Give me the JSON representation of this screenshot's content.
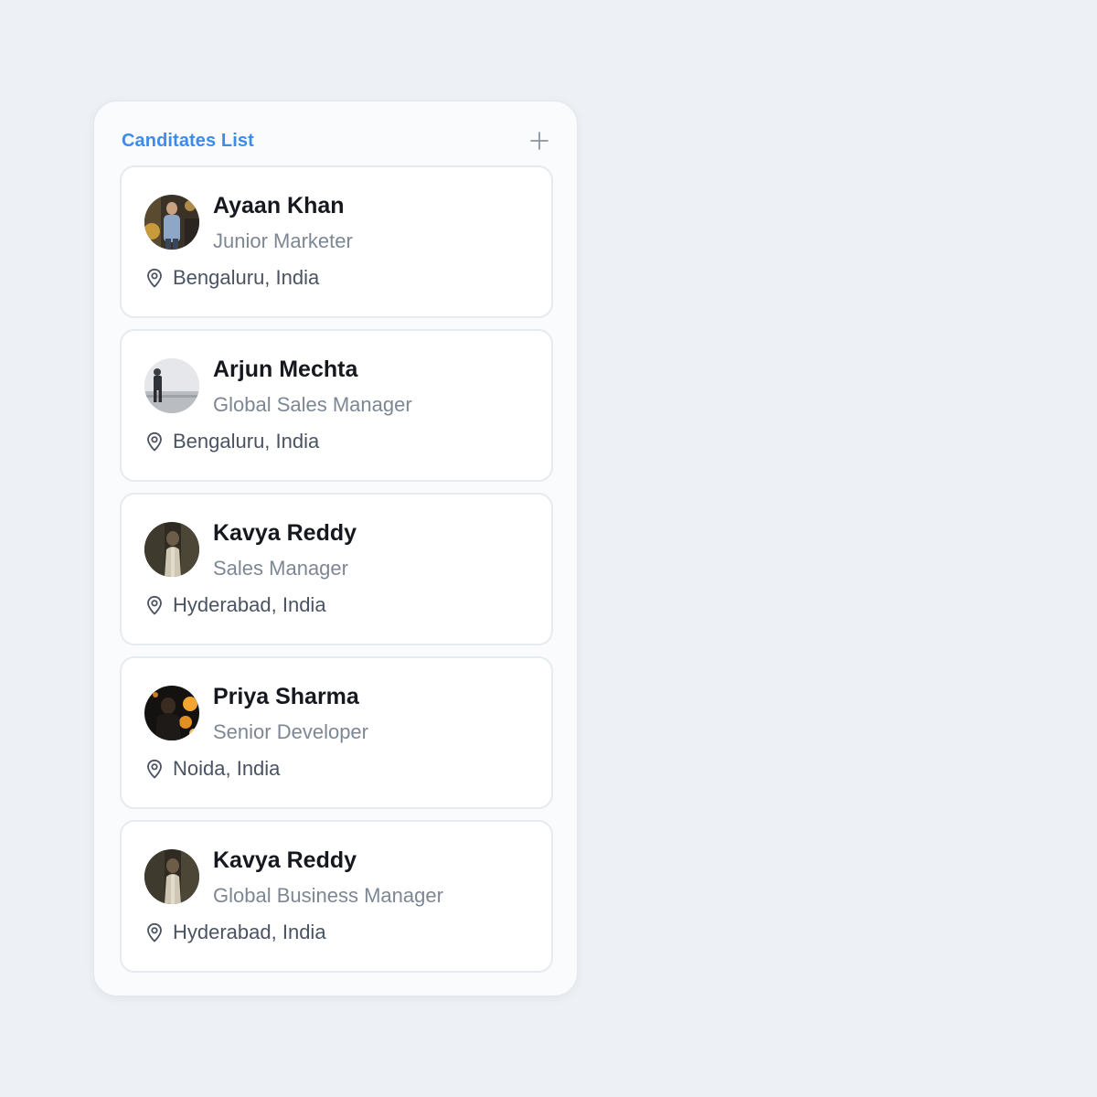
{
  "panel": {
    "title": "Canditates List",
    "add_icon": "plus-icon",
    "accent_color": "#3d8bea"
  },
  "candidates": [
    {
      "name": "Ayaan Khan",
      "role": "Junior Marketer",
      "location": "Bengaluru, India",
      "location_icon": "map-pin-icon"
    },
    {
      "name": "Arjun Mechta",
      "role": "Global Sales Manager",
      "location": "Bengaluru, India",
      "location_icon": "map-pin-icon"
    },
    {
      "name": "Kavya Reddy",
      "role": "Sales Manager",
      "location": "Hyderabad, India",
      "location_icon": "map-pin-icon"
    },
    {
      "name": "Priya Sharma",
      "role": "Senior Developer",
      "location": "Noida, India",
      "location_icon": "map-pin-icon"
    },
    {
      "name": "Kavya Reddy",
      "role": "Global Business Manager",
      "location": "Hyderabad, India",
      "location_icon": "map-pin-icon"
    }
  ]
}
